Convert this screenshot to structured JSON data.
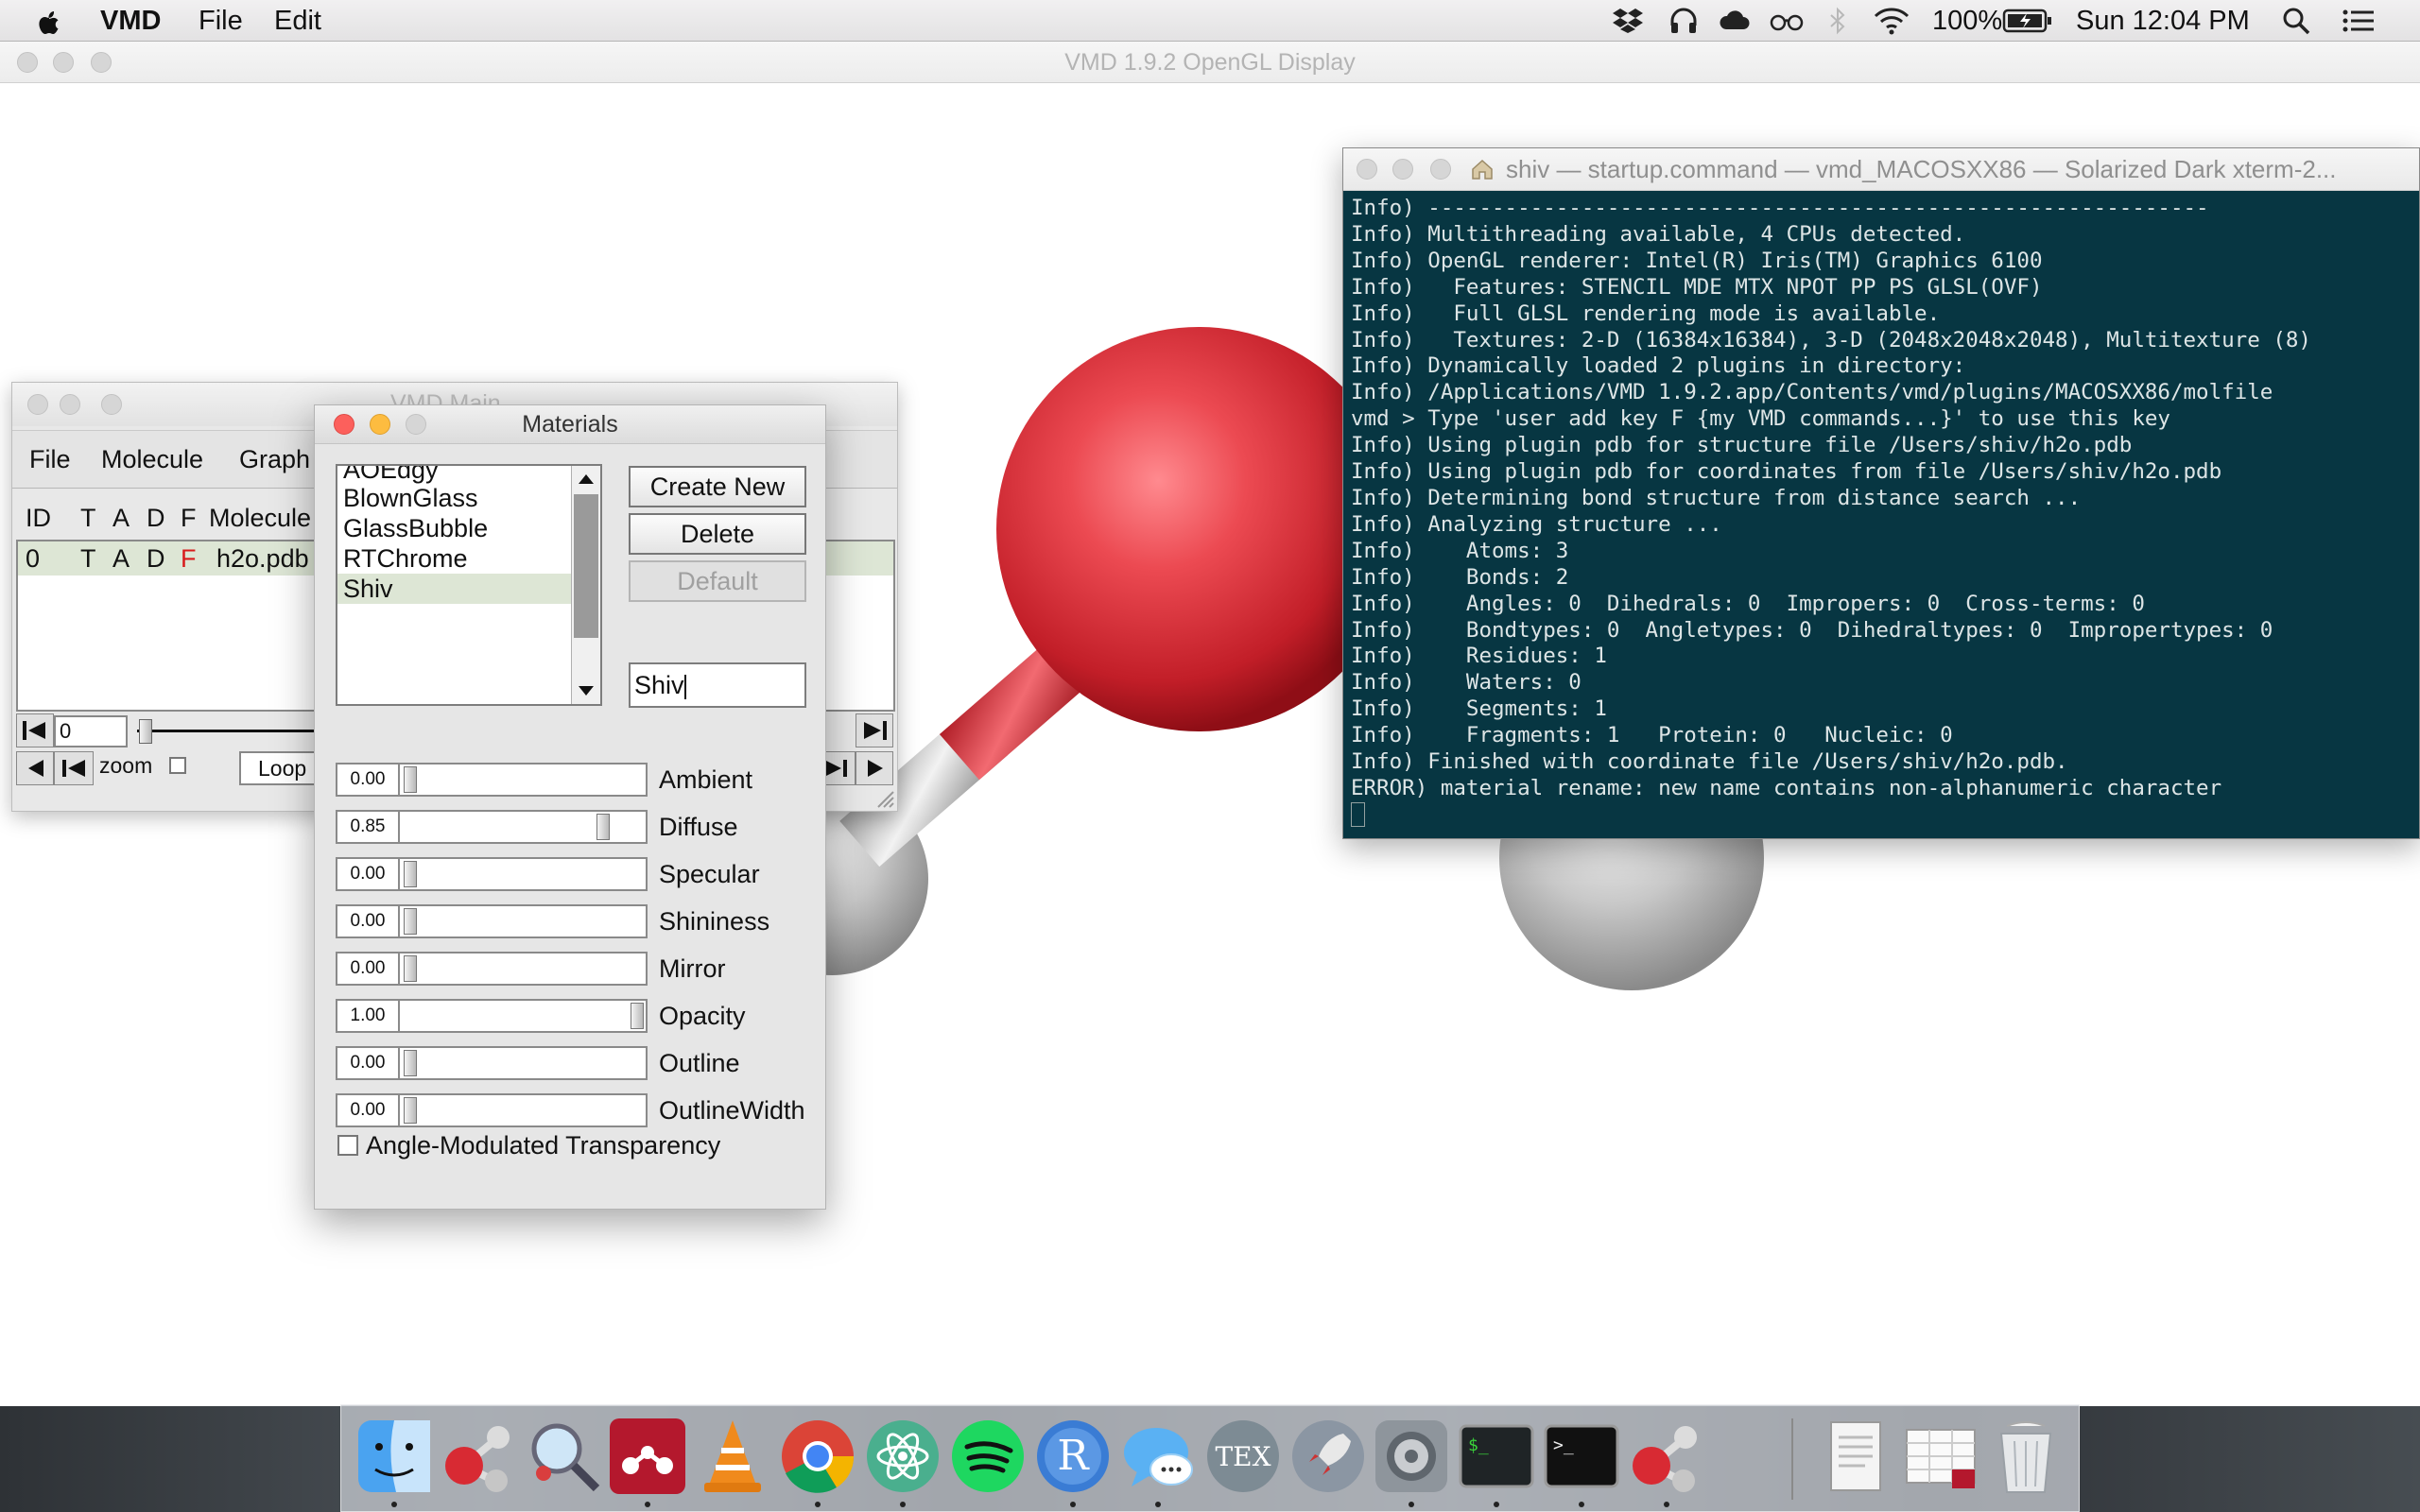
{
  "menubar": {
    "app_name": "VMD",
    "menus": [
      "File",
      "Edit"
    ],
    "battery": "100%",
    "clock": "Sun 12:04 PM",
    "icons": [
      "apple-icon",
      "dropbox-icon",
      "headphones-icon",
      "cloud-icon",
      "glasses-icon",
      "bluetooth-icon",
      "wifi-icon",
      "battery-icon",
      "spotlight-icon",
      "notification-center-icon"
    ]
  },
  "gl_window": {
    "title": "VMD 1.9.2 OpenGL Display"
  },
  "vmd_main": {
    "title": "VMD Main",
    "menus": [
      "File",
      "Molecule",
      "Graph"
    ],
    "headers": [
      "ID",
      "T",
      "A",
      "D",
      "F",
      "Molecule"
    ],
    "rows": [
      {
        "id": "0",
        "t": "T",
        "a": "A",
        "d": "D",
        "f": "F",
        "molecule": "h2o.pdb"
      }
    ],
    "frame_value": "0",
    "zoom_label": "zoom",
    "loop_value": "Loop"
  },
  "materials": {
    "title": "Materials",
    "list": [
      "AOEdgy",
      "BlownGlass",
      "GlassBubble",
      "RTChrome",
      "Shiv"
    ],
    "selected": "Shiv",
    "buttons": {
      "create": "Create New",
      "delete": "Delete",
      "default": "Default"
    },
    "name_field": "Shiv",
    "properties": [
      {
        "label": "Ambient",
        "value": "0.00",
        "level": 0.0
      },
      {
        "label": "Diffuse",
        "value": "0.85",
        "level": 0.85
      },
      {
        "label": "Specular",
        "value": "0.00",
        "level": 0.0
      },
      {
        "label": "Shininess",
        "value": "0.00",
        "level": 0.0
      },
      {
        "label": "Mirror",
        "value": "0.00",
        "level": 0.0
      },
      {
        "label": "Opacity",
        "value": "1.00",
        "level": 1.0
      },
      {
        "label": "Outline",
        "value": "0.00",
        "level": 0.0
      },
      {
        "label": "OutlineWidth",
        "value": "0.00",
        "level": 0.0
      }
    ],
    "checkbox_label": "Angle-Modulated Transparency"
  },
  "terminal": {
    "title": "shiv — startup.command — vmd_MACOSXX86 — Solarized Dark xterm-2...",
    "lines": [
      "Info) -------------------------------------------------------------",
      "Info) Multithreading available, 4 CPUs detected.",
      "Info) OpenGL renderer: Intel(R) Iris(TM) Graphics 6100",
      "Info)   Features: STENCIL MDE MTX NPOT PP PS GLSL(OVF)",
      "Info)   Full GLSL rendering mode is available.",
      "Info)   Textures: 2-D (16384x16384), 3-D (2048x2048x2048), Multitexture (8)",
      "Info) Dynamically loaded 2 plugins in directory:",
      "Info) /Applications/VMD 1.9.2.app/Contents/vmd/plugins/MACOSXX86/molfile",
      "vmd > Type 'user add key F {my VMD commands...}' to use this key",
      "Info) Using plugin pdb for structure file /Users/shiv/h2o.pdb",
      "Info) Using plugin pdb for coordinates from file /Users/shiv/h2o.pdb",
      "Info) Determining bond structure from distance search ...",
      "Info) Analyzing structure ...",
      "Info)    Atoms: 3",
      "Info)    Bonds: 2",
      "Info)    Angles: 0  Dihedrals: 0  Impropers: 0  Cross-terms: 0",
      "Info)    Bondtypes: 0  Angletypes: 0  Dihedraltypes: 0  Impropertypes: 0",
      "Info)    Residues: 1",
      "Info)    Waters: 0",
      "Info)    Segments: 1",
      "Info)    Fragments: 1   Protein: 0   Nucleic: 0",
      "Info) Finished with coordinate file /Users/shiv/h2o.pdb.",
      "ERROR) material rename: new name contains non-alphanumeric character"
    ]
  },
  "dock": {
    "apps": [
      "finder",
      "vmd",
      "preview",
      "mendeley",
      "vlc",
      "chrome",
      "atom",
      "spotify",
      "r",
      "messages",
      "tex",
      "launchpad",
      "system-preferences",
      "terminal-green",
      "terminal",
      "vmd-2",
      "documents",
      "tables",
      "trash"
    ]
  },
  "colors": {
    "terminal_bg": "#073642",
    "terminal_fg": "#dde5e6",
    "oxygen": "#e03a45",
    "hydrogen": "#cfcfcf",
    "selection": "#dde6d5",
    "error_red": "#d81b1b"
  }
}
